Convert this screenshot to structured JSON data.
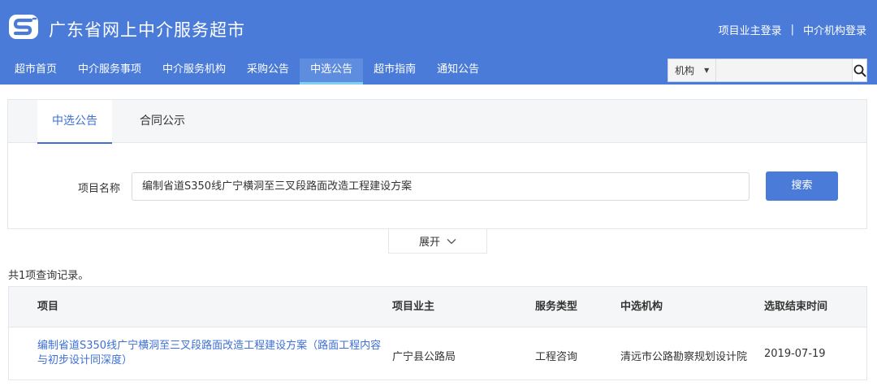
{
  "header": {
    "title": "广东省网上中介服务超市",
    "owner_login": "项目业主登录",
    "separator": "|",
    "agency_login": "中介机构登录"
  },
  "nav": [
    {
      "label": "超市首页"
    },
    {
      "label": "中介服务事项"
    },
    {
      "label": "中介服务机构"
    },
    {
      "label": "采购公告"
    },
    {
      "label": "中选公告",
      "active": true
    },
    {
      "label": "超市指南"
    },
    {
      "label": "通知公告"
    }
  ],
  "search": {
    "select_value": "机构",
    "input_value": "",
    "icon": "search-icon"
  },
  "tabs": {
    "active": "中选公告",
    "inactive": "合同公示"
  },
  "form": {
    "label": "项目名称",
    "value": "编制省道S350线广宁横洞至三叉段路面改造工程建设方案",
    "submit": "搜索"
  },
  "expand": {
    "label": "展开",
    "icon": "chevron-down-icon"
  },
  "results": {
    "count_text": "共1项查询记录。",
    "headers": [
      "项目",
      "项目业主",
      "服务类型",
      "中选机构",
      "选取结束时间"
    ],
    "rows": [
      {
        "project": "编制省道S350线广宁横洞至三叉段路面改造工程建设方案（路面工程内容与初步设计同深度）",
        "owner": "广宁县公路局",
        "service_type": "工程咨询",
        "agency": "清远市公路勘察规划设计院",
        "end_date": "2019-07-19"
      }
    ]
  },
  "colors": {
    "header_bg": "#4a7bd8",
    "accent": "#3d6fd6",
    "active_underline": "#7dd1f0"
  }
}
